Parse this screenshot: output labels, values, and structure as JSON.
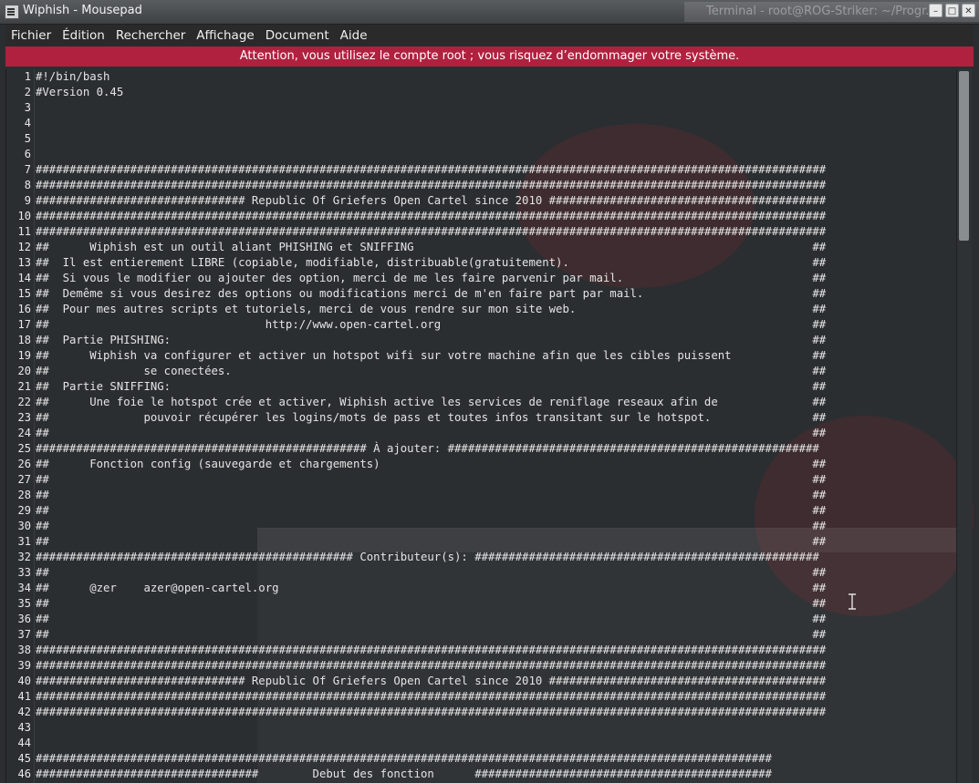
{
  "window": {
    "title": "Wiphish - Mousepad",
    "background_window_title": "Terminal - root@ROG-Striker: ~/Progr..."
  },
  "menu": [
    "Fichier",
    "Édition",
    "Rechercher",
    "Affichage",
    "Document",
    "Aide"
  ],
  "warning": "Attention, vous utilisez le compte root ; vous risquez d’endommager votre système.",
  "colors": {
    "warning_bar": "#b0213f",
    "editor_background": "#2b2e31",
    "text": "#e4e4e4"
  },
  "icons": [
    "app-icon",
    "minimize-icon",
    "maximize-icon",
    "close-icon",
    "text-cursor-icon"
  ],
  "editor": {
    "lines": [
      "#!/bin/bash",
      "#Version 0.45",
      "",
      "",
      "",
      "",
      "#####################################################################################################################",
      "#####################################################################################################################",
      "############################### Republic Of Griefers Open Cartel since 2010 #########################################",
      "#####################################################################################################################",
      "#####################################################################################################################",
      "##      Wiphish est un outil aliant PHISHING et SNIFFING                                                           ##",
      "##  Il est entierement LIBRE (copiable, modifiable, distribuable(gratuitement).                                    ##",
      "##  Si vous le modifier ou ajouter des option, merci de me les faire parvenir par mail.                            ##",
      "##  Demême si vous desirez des options ou modifications merci de m'en faire part par mail.                         ##",
      "##  Pour mes autres scripts et tutoriels, merci de vous rendre sur mon site web.                                   ##",
      "##                                http://www.open-cartel.org                                                       ##",
      "##  Partie PHISHING:                                                                                               ##",
      "##      Wiphish va configurer et activer un hotspot wifi sur votre machine afin que les cibles puissent            ##",
      "##              se conectées.                                                                                      ##",
      "##  Partie SNIFFING:                                                                                               ##",
      "##      Une foie le hotspot crée et activer, Wiphish active les services de reniflage reseaux afin de              ##",
      "##              pouvoir récupérer les logins/mots de pass et toutes infos transitant sur le hotspot.               ##",
      "##                                                                                                                 ##",
      "################################################# À ajouter: #######################################################",
      "##      Fonction config (sauvegarde et chargements)                                                                ##",
      "##                                                                                                                 ##",
      "##                                                                                                                 ##",
      "##                                                                                                                 ##",
      "##                                                                                                                 ##",
      "##                                                                                                                 ##",
      "############################################### Contributeur(s): ###################################################",
      "##                                                                                                                 ##",
      "##      @zer    azer@open-cartel.org                                                                               ##",
      "##                                                                                                                 ##",
      "##                                                                                                                 ##",
      "##                                                                                                                 ##",
      "#####################################################################################################################",
      "#####################################################################################################################",
      "############################### Republic Of Griefers Open Cartel since 2010 #########################################",
      "#####################################################################################################################",
      "#####################################################################################################################",
      "",
      "",
      "#############################################################################################################",
      "#################################        Debut des fonction      ############################################"
    ]
  }
}
